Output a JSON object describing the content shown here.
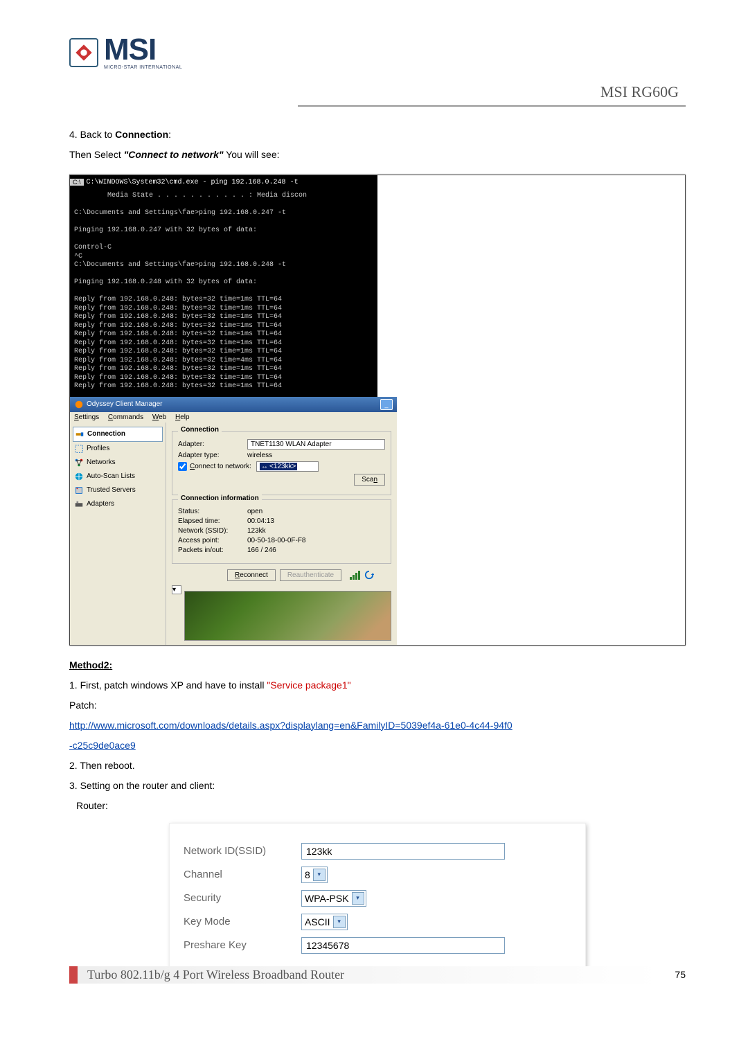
{
  "header": {
    "brand": "MSI",
    "brand_sub": "MICRO-STAR INTERNATIONAL",
    "model": "MSI RG60G"
  },
  "step4": {
    "num": "4.",
    "back": " Back to ",
    "conn": "Connection",
    "colon": ":",
    "then": "Then Select ",
    "quote": "\"Connect to network\"",
    "tail": " You will see:"
  },
  "term": {
    "cmd_icon": "C:\\",
    "title": "C:\\WINDOWS\\System32\\cmd.exe - ping 192.168.0.248 -t",
    "body": "        Media State . . . . . . . . . . . : Media discon\n\nC:\\Documents and Settings\\fae>ping 192.168.0.247 -t\n\nPinging 192.168.0.247 with 32 bytes of data:\n\nControl-C\n^C\nC:\\Documents and Settings\\fae>ping 192.168.0.248 -t\n\nPinging 192.168.0.248 with 32 bytes of data:\n\nReply from 192.168.0.248: bytes=32 time=1ms TTL=64\nReply from 192.168.0.248: bytes=32 time=1ms TTL=64\nReply from 192.168.0.248: bytes=32 time=1ms TTL=64\nReply from 192.168.0.248: bytes=32 time=1ms TTL=64\nReply from 192.168.0.248: bytes=32 time=1ms TTL=64\nReply from 192.168.0.248: bytes=32 time=1ms TTL=64\nReply from 192.168.0.248: bytes=32 time=1ms TTL=64\nReply from 192.168.0.248: bytes=32 time=4ms TTL=64\nReply from 192.168.0.248: bytes=32 time=1ms TTL=64\nReply from 192.168.0.248: bytes=32 time=1ms TTL=64\nReply from 192.168.0.248: bytes=32 time=1ms TTL=64"
  },
  "ody": {
    "title": "Odyssey Client Manager",
    "menu": {
      "s": "Settings",
      "c": "Commands",
      "w": "Web",
      "h": "Help"
    },
    "nav": [
      "Connection",
      "Profiles",
      "Networks",
      "Auto-Scan Lists",
      "Trusted Servers",
      "Adapters"
    ],
    "grp1": {
      "title": "Connection",
      "adapter_l": "Adapter:",
      "adapter_v": "TNET1130 WLAN Adapter",
      "atype_l": "Adapter type:",
      "atype_v": "wireless",
      "cnet": "Connect to network:",
      "cnet_v": "<123kk>",
      "scan": "Scan"
    },
    "grp2": {
      "title": "Connection information",
      "status_l": "Status:",
      "status_v": "open",
      "elapsed_l": "Elapsed time:",
      "elapsed_v": "00:04:13",
      "ssid_l": "Network (SSID):",
      "ssid_v": "123kk",
      "ap_l": "Access point:",
      "ap_v": "00-50-18-00-0F-F8",
      "pkt_l": "Packets in/out:",
      "pkt_v": "166 / 246"
    },
    "btns": {
      "reconnect": "Reconnect",
      "reauth": "Reauthenticate"
    }
  },
  "method2": {
    "title": "Method2:",
    "s1a": "1. First, patch windows XP and have to install ",
    "s1b": "\"Service package1\"",
    "patch": "Patch:",
    "link1": "http://www.microsoft.com/downloads/details.aspx?displaylang=en&FamilyID=5039ef4a-61e0-4c44-94f0",
    "link2": "-c25c9de0ace9",
    "s2": "2. Then reboot.",
    "s3": "3. Setting on the router and client:",
    "router": "Router:"
  },
  "router": {
    "ssid_l": "Network ID(SSID)",
    "ssid_v": "123kk",
    "chan_l": "Channel",
    "chan_v": "8",
    "sec_l": "Security",
    "sec_v": "WPA-PSK",
    "km_l": "Key Mode",
    "km_v": "ASCII",
    "psk_l": "Preshare Key",
    "psk_v": "12345678"
  },
  "footer": {
    "line": "Turbo 802.11b/g 4 Port Wireless Broadband Router",
    "page": "75"
  }
}
